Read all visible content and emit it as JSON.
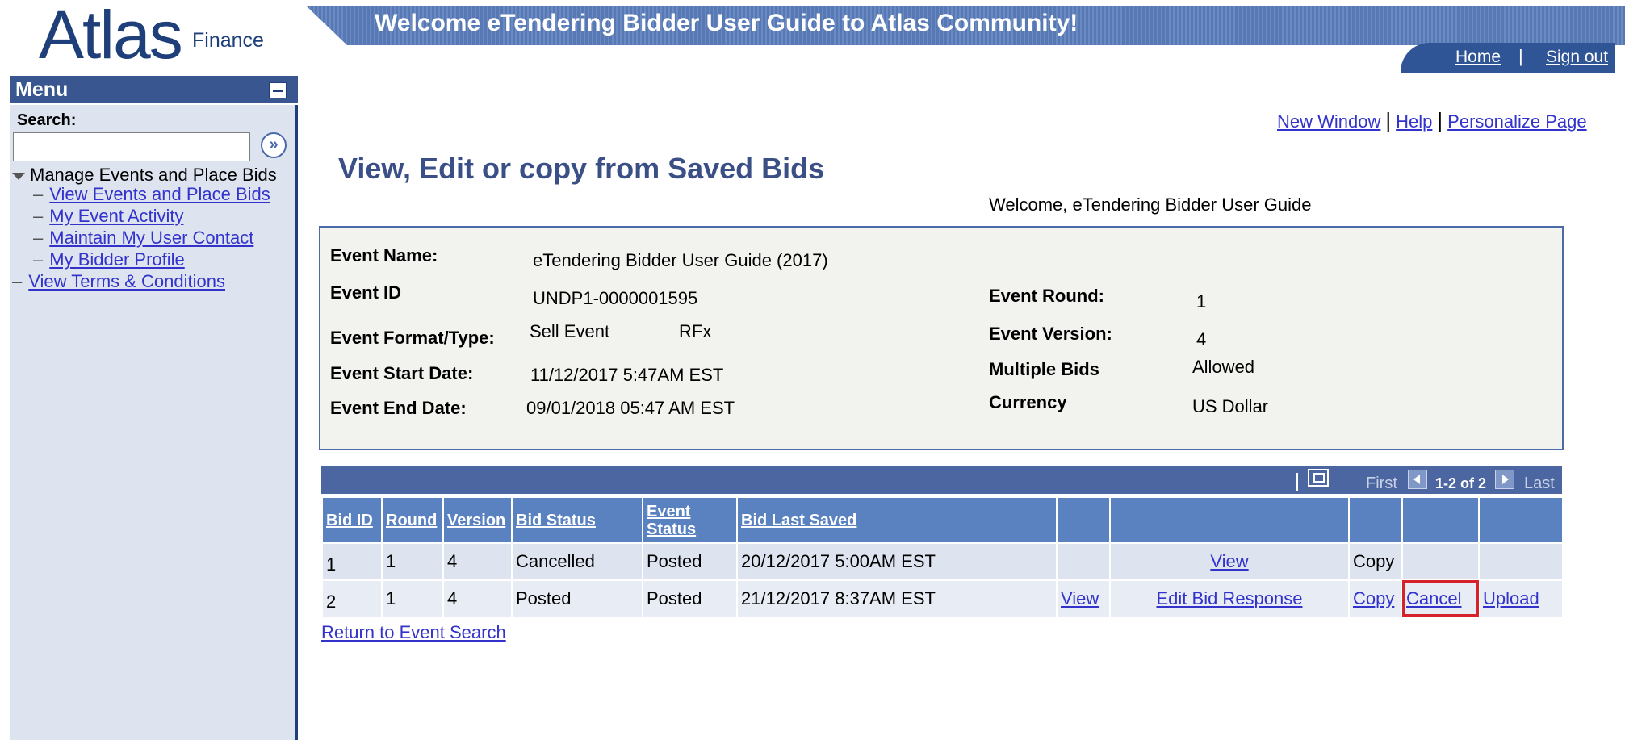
{
  "header": {
    "logo_main": "Atlas",
    "logo_sub": "Finance",
    "banner_title": "Welcome eTendering Bidder User Guide to Atlas Community!",
    "home_link": "Home",
    "separator": "|",
    "signout_link": "Sign out"
  },
  "sidebar": {
    "menu_title": "Menu",
    "search_label": "Search:",
    "search_value": "",
    "search_go_glyph": "»",
    "group_label": "Manage Events and Place Bids",
    "items": [
      {
        "label": "View Events and Place Bids"
      },
      {
        "label": "My Event Activity"
      },
      {
        "label": "Maintain My User Contact"
      },
      {
        "label": "My Bidder Profile"
      }
    ],
    "terms_link": "View Terms & Conditions",
    "dash": "–"
  },
  "page_links": {
    "new_window": "New Window",
    "help": "Help",
    "personalize": "Personalize Page",
    "separator": "|"
  },
  "page": {
    "title": "View, Edit or copy from Saved Bids",
    "welcome": "Welcome, eTendering Bidder User Guide"
  },
  "event": {
    "name_label": "Event Name:",
    "name_value": "eTendering Bidder User Guide (2017)",
    "id_label": "Event ID",
    "id_value": "UNDP1-0000001595",
    "format_label": "Event Format/Type:",
    "format_value": "Sell Event",
    "type_value": "RFx",
    "start_label": "Event Start Date:",
    "start_value": "11/12/2017  5:47AM EST",
    "end_label": "Event End Date:",
    "end_value": "09/01/2018 05:47 AM EST",
    "round_label": "Event Round:",
    "round_value": "1",
    "version_label": "Event Version:",
    "version_value": "4",
    "multiple_label": "Multiple Bids",
    "multiple_value": "Allowed",
    "currency_label": "Currency",
    "currency_value": "US Dollar"
  },
  "grid": {
    "first_label": "First",
    "range": "1-2 of 2",
    "last_label": "Last",
    "columns": {
      "bid_id": "Bid ID",
      "round": "Round",
      "version": "Version",
      "bid_status": "Bid Status",
      "event_status": "Event Status",
      "bid_last_saved": "Bid Last Saved"
    },
    "rows": [
      {
        "bid_id": "1",
        "round": "1",
        "version": "4",
        "bid_status": "Cancelled",
        "event_status": "Posted",
        "saved": "20/12/2017  5:00AM EST",
        "view": "",
        "edit": "View",
        "copy": "Copy",
        "cancel": "",
        "upload": ""
      },
      {
        "bid_id": "2",
        "round": "1",
        "version": "4",
        "bid_status": "Posted",
        "event_status": "Posted",
        "saved": "21/12/2017  8:37AM EST",
        "view": "View",
        "edit": "Edit Bid Response",
        "copy": "Copy",
        "cancel": "Cancel",
        "upload": "Upload"
      }
    ]
  },
  "return_link": "Return to Event Search",
  "colors": {
    "accent": "#3a5690",
    "header_blue": "#5b82c0",
    "link": "#3333cc",
    "highlight": "#d6222a"
  }
}
